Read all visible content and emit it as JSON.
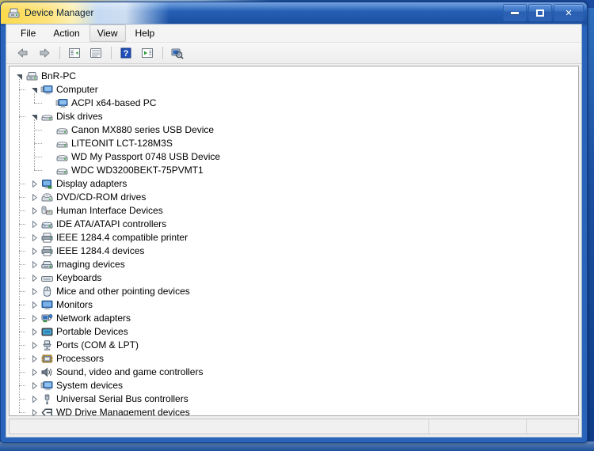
{
  "window": {
    "title": "Device Manager",
    "title_icon": "device-manager-icon",
    "controls": {
      "minimize": "Minimize",
      "maximize": "Maximize",
      "close": "Close"
    }
  },
  "menu": {
    "items": [
      {
        "label": "File",
        "active": false
      },
      {
        "label": "Action",
        "active": false
      },
      {
        "label": "View",
        "active": true
      },
      {
        "label": "Help",
        "active": false
      }
    ]
  },
  "toolbar": {
    "buttons": [
      {
        "name": "back-icon",
        "kind": "sep-after-no"
      },
      {
        "name": "forward-icon",
        "kind": "sep-after-yes"
      },
      {
        "name": "show-hide-console-tree-icon",
        "kind": "sep-after-no"
      },
      {
        "name": "properties-icon",
        "kind": "sep-after-yes"
      },
      {
        "name": "help-icon",
        "kind": "sep-after-no"
      },
      {
        "name": "update-driver-software-icon",
        "kind": "sep-after-yes"
      },
      {
        "name": "scan-for-hardware-changes-icon",
        "kind": "sep-after-no"
      }
    ]
  },
  "tree": {
    "root": {
      "label": "BnR-PC",
      "icon": "computer-root-icon",
      "expanded": true
    },
    "nodes": [
      {
        "label": "Computer",
        "icon": "computer-icon",
        "level": 1,
        "expanded": true
      },
      {
        "label": "ACPI x64-based PC",
        "icon": "computer-icon",
        "level": 2,
        "leaf": true
      },
      {
        "label": "Disk drives",
        "icon": "disk-drive-icon",
        "level": 1,
        "expanded": true
      },
      {
        "label": "Canon MX880 series USB Device",
        "icon": "disk-drive-icon",
        "level": 2,
        "leaf": true
      },
      {
        "label": "LITEONIT LCT-128M3S",
        "icon": "disk-drive-icon",
        "level": 2,
        "leaf": true
      },
      {
        "label": "WD My Passport 0748 USB Device",
        "icon": "disk-drive-icon",
        "level": 2,
        "leaf": true
      },
      {
        "label": "WDC WD3200BEKT-75PVMT1",
        "icon": "disk-drive-icon",
        "level": 2,
        "leaf": true
      },
      {
        "label": "Display adapters",
        "icon": "display-adapter-icon",
        "level": 1,
        "expanded": false
      },
      {
        "label": "DVD/CD-ROM drives",
        "icon": "dvd-drive-icon",
        "level": 1,
        "expanded": false
      },
      {
        "label": "Human Interface Devices",
        "icon": "hid-icon",
        "level": 1,
        "expanded": false
      },
      {
        "label": "IDE ATA/ATAPI controllers",
        "icon": "ide-controller-icon",
        "level": 1,
        "expanded": false
      },
      {
        "label": "IEEE 1284.4 compatible printer",
        "icon": "printer-icon",
        "level": 1,
        "expanded": false
      },
      {
        "label": "IEEE 1284.4 devices",
        "icon": "printer-icon",
        "level": 1,
        "expanded": false
      },
      {
        "label": "Imaging devices",
        "icon": "imaging-device-icon",
        "level": 1,
        "expanded": false
      },
      {
        "label": "Keyboards",
        "icon": "keyboard-icon",
        "level": 1,
        "expanded": false
      },
      {
        "label": "Mice and other pointing devices",
        "icon": "mouse-icon",
        "level": 1,
        "expanded": false
      },
      {
        "label": "Monitors",
        "icon": "monitor-icon",
        "level": 1,
        "expanded": false
      },
      {
        "label": "Network adapters",
        "icon": "network-adapter-icon",
        "level": 1,
        "expanded": false
      },
      {
        "label": "Portable Devices",
        "icon": "portable-device-icon",
        "level": 1,
        "expanded": false
      },
      {
        "label": "Ports (COM & LPT)",
        "icon": "port-icon",
        "level": 1,
        "expanded": false
      },
      {
        "label": "Processors",
        "icon": "processor-icon",
        "level": 1,
        "expanded": false
      },
      {
        "label": "Sound, video and game controllers",
        "icon": "sound-controller-icon",
        "level": 1,
        "expanded": false
      },
      {
        "label": "System devices",
        "icon": "system-device-icon",
        "level": 1,
        "expanded": false
      },
      {
        "label": "Universal Serial Bus controllers",
        "icon": "usb-controller-icon",
        "level": 1,
        "expanded": false
      },
      {
        "label": "WD Drive Management devices",
        "icon": "wd-drive-management-icon",
        "level": 1,
        "expanded": false
      }
    ]
  },
  "statusbar": {
    "panes": [
      {
        "text": ""
      },
      {
        "text": ""
      },
      {
        "text": ""
      }
    ]
  },
  "colors": {
    "titlebar_blue": "#255fb4",
    "titlebar_highlight_yellow": "#fbd94a",
    "window_frame": "#2a64ba",
    "toolbar_bg": "#f2f2f2",
    "tree_bg": "#ffffff",
    "text": "#000000"
  }
}
